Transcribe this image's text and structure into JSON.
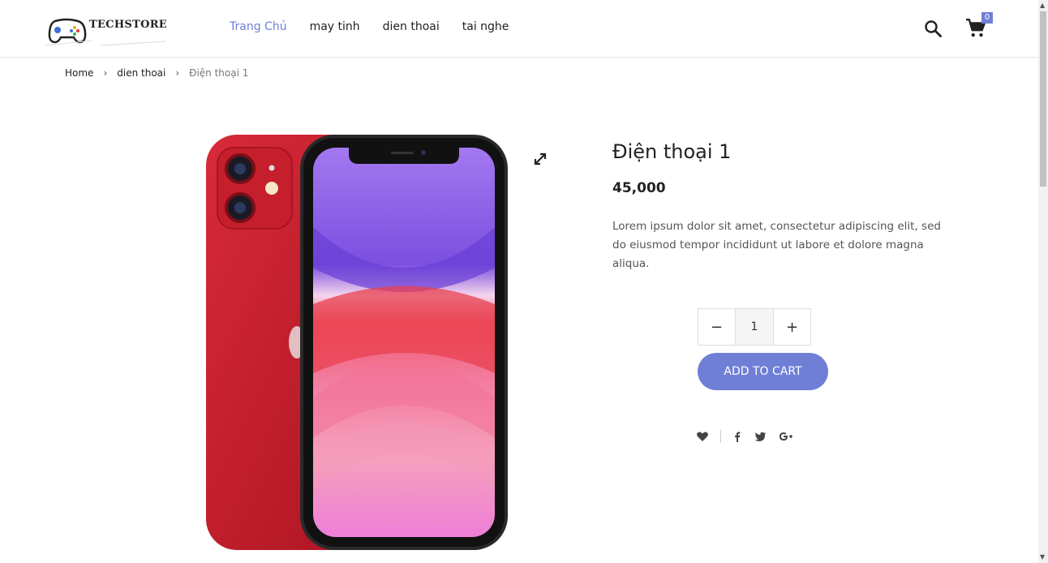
{
  "brand": {
    "name": "TECHSTORE"
  },
  "nav": {
    "items": [
      {
        "label": "Trang Chủ",
        "active": true
      },
      {
        "label": "may tinh",
        "active": false
      },
      {
        "label": "dien thoai",
        "active": false
      },
      {
        "label": "tai nghe",
        "active": false
      }
    ]
  },
  "cart": {
    "count": "0"
  },
  "breadcrumb": {
    "home": "Home",
    "category": "dien thoai",
    "current": "Điện thoại 1"
  },
  "product": {
    "title": "Điện thoại 1",
    "price": "45,000",
    "description": "Lorem ipsum dolor sit amet, consectetur adipiscing elit, sed do eiusmod tempor incididunt ut labore et dolore magna aliqua.",
    "quantity": "1",
    "minus_label": "−",
    "plus_label": "+",
    "add_to_cart_label": "ADD TO CART"
  },
  "colors": {
    "accent": "#6f7fd6",
    "phone_red": "#c8202e"
  },
  "icons": [
    "gamepad-logo-icon",
    "search-icon",
    "cart-icon",
    "expand-icon",
    "heart-icon",
    "facebook-icon",
    "twitter-icon",
    "google-plus-icon"
  ]
}
